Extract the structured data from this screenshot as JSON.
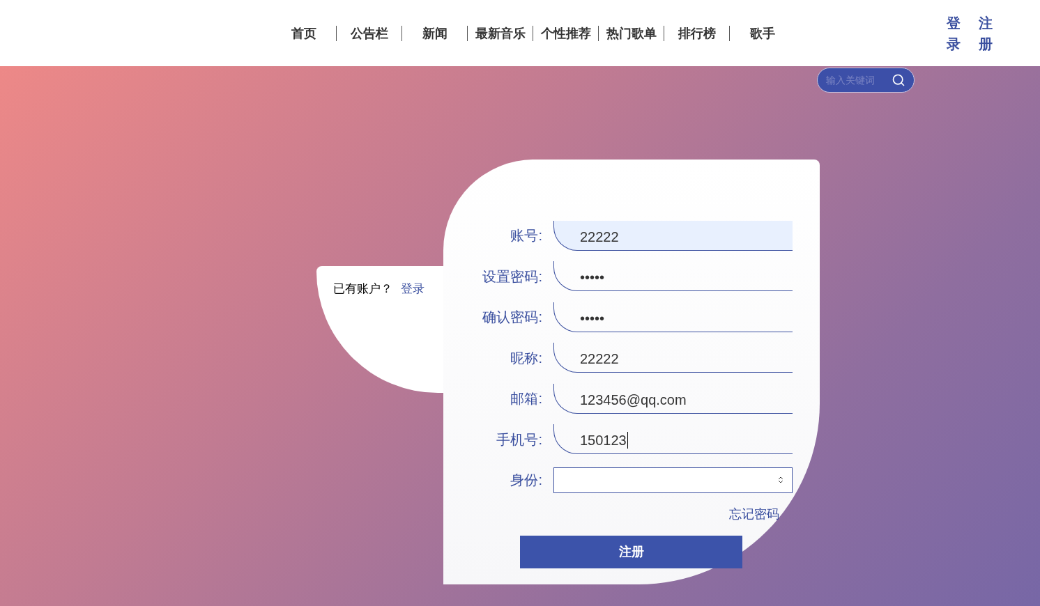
{
  "nav": [
    {
      "label": "首页"
    },
    {
      "label": "公告栏"
    },
    {
      "label": "新闻"
    },
    {
      "label": "最新音乐"
    },
    {
      "label": "个性推荐"
    },
    {
      "label": "热门歌单"
    },
    {
      "label": "排行榜"
    },
    {
      "label": "歌手"
    }
  ],
  "auth_links": [
    "登录",
    "注册"
  ],
  "search": {
    "placeholder": "输入关键词"
  },
  "side_tab": {
    "text": "已有账户？",
    "link": "登录"
  },
  "form": {
    "fields": [
      {
        "kind": "text",
        "label": "账号:",
        "value": "22222",
        "autofilled": true,
        "focused": false
      },
      {
        "kind": "text",
        "label": "设置密码:",
        "value": "•••••",
        "autofilled": false,
        "focused": false
      },
      {
        "kind": "text",
        "label": "确认密码:",
        "value": "•••••",
        "autofilled": false,
        "focused": false
      },
      {
        "kind": "text",
        "label": "昵称:",
        "value": "22222",
        "autofilled": false,
        "focused": false
      },
      {
        "kind": "text",
        "label": "邮箱:",
        "value": "123456@qq.com",
        "autofilled": false,
        "focused": false
      },
      {
        "kind": "text",
        "label": "手机号:",
        "value": "150123",
        "autofilled": false,
        "focused": true
      },
      {
        "kind": "select",
        "label": "身份:"
      }
    ],
    "forgot_link": "忘记密码",
    "submit": "注册"
  }
}
